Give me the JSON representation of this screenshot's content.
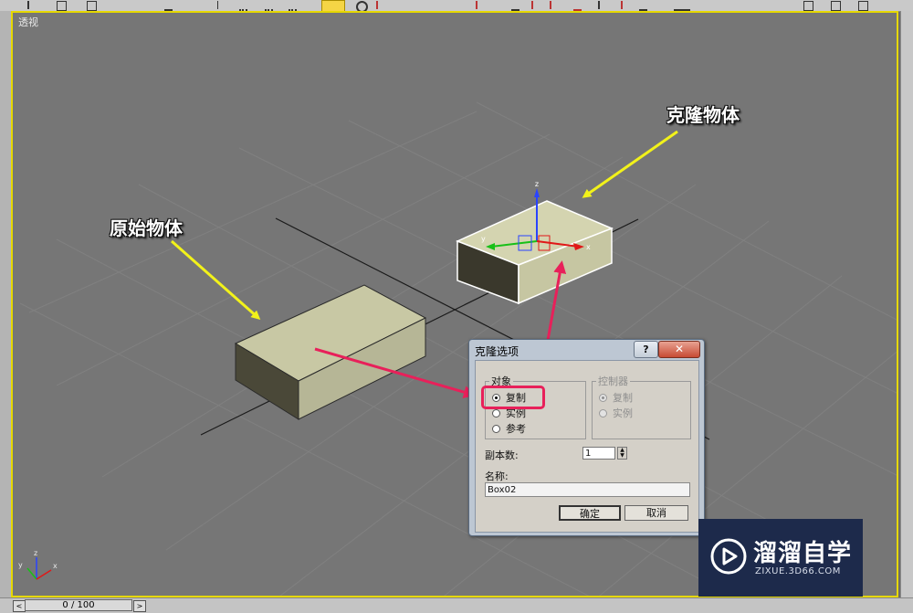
{
  "viewport": {
    "label": "透视",
    "axes_mini": {
      "x": "x",
      "y": "y",
      "z": "z"
    },
    "gizmo": {
      "x": "x",
      "y": "y",
      "z": "z"
    }
  },
  "annotations": {
    "original": "原始物体",
    "clone": "克隆物体"
  },
  "dialog": {
    "title": "克隆选项",
    "help_label": "?",
    "close_label": "✕",
    "object_group": {
      "legend": "对象",
      "options": [
        "复制",
        "实例",
        "参考"
      ],
      "selected": "复制"
    },
    "controller_group": {
      "legend": "控制器",
      "options": [
        "复制",
        "实例"
      ],
      "selected": "复制",
      "disabled": true
    },
    "copies_label": "副本数:",
    "copies_value": "1",
    "name_label": "名称:",
    "name_value": "Box02",
    "ok_label": "确定",
    "cancel_label": "取消"
  },
  "watermark": {
    "title": "溜溜自学",
    "url": "ZIXUE.3D66.COM"
  },
  "timeline": {
    "prev": "<",
    "position": "0 / 100",
    "next": ">"
  },
  "colors": {
    "viewport_border": "#e6d800",
    "highlight": "#e8205a",
    "arrow_yellow": "#f2f21a",
    "watermark_bg": "#1d2a4b"
  }
}
